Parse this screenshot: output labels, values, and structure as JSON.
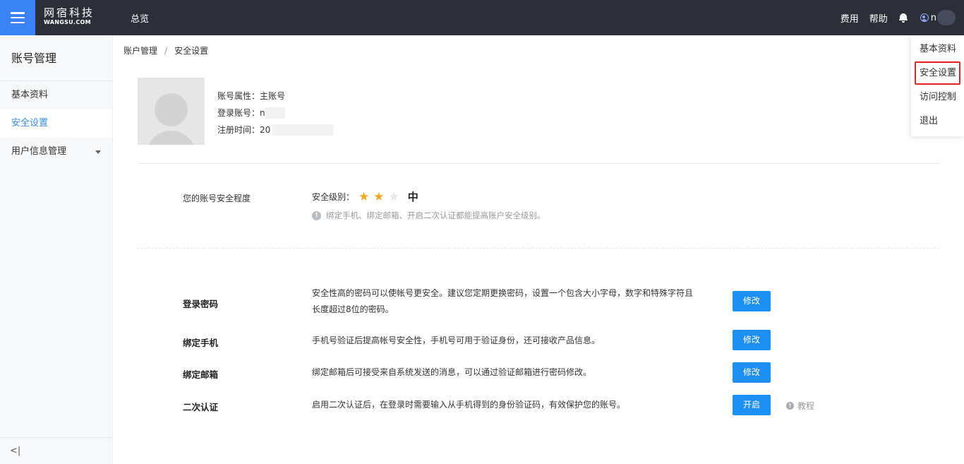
{
  "header": {
    "logo_cn": "网宿科技",
    "logo_en": "WANGSU.COM",
    "nav_overview": "总览",
    "links": {
      "billing": "费用",
      "help": "帮助"
    },
    "user_name_partial": "n",
    "icons": [
      "menu-icon",
      "bell-icon",
      "user-icon"
    ],
    "accent_color": "#3b82f6",
    "bar_color": "#2d2f38"
  },
  "sidebar": {
    "title": "账号管理",
    "items": [
      {
        "label": "基本资料"
      },
      {
        "label": "安全设置",
        "active": true
      },
      {
        "label": "用户信息管理",
        "has_submenu": true
      }
    ],
    "collapse_icon": "<|"
  },
  "breadcrumb": {
    "items": [
      "账户管理",
      "安全设置"
    ],
    "separator": "/"
  },
  "account": {
    "attr_label": "账号属性：",
    "attr_value": "主账号",
    "login_label": "登录账号：",
    "login_value_partial": "n",
    "reg_label": "注册时间：",
    "reg_value_partial": "20"
  },
  "security": {
    "section_label": "您的账号安全程度",
    "level_label": "安全级别：",
    "stars_filled": 2,
    "stars_total": 3,
    "level_text": "中",
    "hint_icon": "!",
    "hint": "绑定手机、绑定邮箱、开启二次认证都能提高账户安全级别。",
    "star_color": "#f5a623"
  },
  "settings": [
    {
      "title": "登录密码",
      "desc": "安全性高的密码可以使帐号更安全。建议您定期更换密码，设置一个包含大小字母，数字和特殊字符且长度超过8位的密码。",
      "button": "修改"
    },
    {
      "title": "绑定手机",
      "desc": "手机号验证后提高帐号安全性，手机号可用于验证身份，还可接收产品信息。",
      "button": "修改"
    },
    {
      "title": "绑定邮箱",
      "desc": "绑定邮箱后可接受来自系统发送的消息，可以通过验证邮箱进行密码修改。",
      "button": "修改"
    },
    {
      "title": "二次认证",
      "desc": "启用二次认证后，在登录时需要输入从手机得到的身份验证码，有效保护您的账号。",
      "button": "开启",
      "extra_link": "教程"
    }
  ],
  "user_menu": {
    "items": [
      "基本资料",
      "安全设置",
      "访问控制",
      "退出"
    ],
    "highlighted": "安全设置",
    "highlight_color": "#e02424"
  },
  "button_color": "#1d8ff2"
}
